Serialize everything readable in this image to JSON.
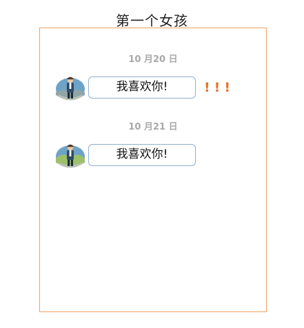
{
  "page": {
    "title": "第一个女孩"
  },
  "conversation": {
    "messages": [
      {
        "date": "10 月20 日",
        "text": "我喜欢你!",
        "suffix": "!!!",
        "avatar_icon": "man-avatar-icon"
      },
      {
        "date": "10 月21 日",
        "text": "我喜欢你!",
        "avatar_icon": "man-avatar-icon"
      }
    ]
  },
  "colors": {
    "frame_border": "#f0a060",
    "bubble_border": "#8fb0cc",
    "date_text": "#a8a8a8",
    "exclamation": "#e8742b"
  }
}
